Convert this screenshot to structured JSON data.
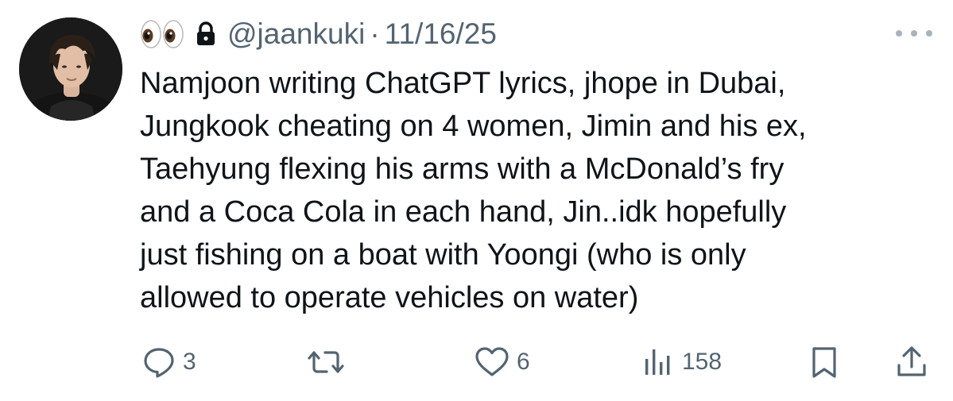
{
  "tweet": {
    "emoji_glyph": "👀",
    "emoji_icon": "eyes-emoji-icon",
    "lock_icon": "lock-icon",
    "handle": "@jaankuki",
    "separator": "·",
    "date": "11/16/25",
    "more_icon": "more-options-icon",
    "text_lines": [
      "Namjoon writing ChatGPT lyrics, jhope in Dubai,",
      "Jungkook cheating on 4 women, Jimin and his ex,",
      "Taehyung flexing his arms with a McDonald’s fry",
      "and a Coca Cola in each hand, Jin..idk hopefully",
      "just fishing on a boat with Yoongi (who is only",
      "allowed to operate vehicles on water)"
    ]
  },
  "actions": {
    "reply": {
      "icon": "reply-icon",
      "count": "3"
    },
    "retweet": {
      "icon": "retweet-icon"
    },
    "like": {
      "icon": "heart-icon",
      "count": "6"
    },
    "views": {
      "icon": "views-chart-icon",
      "count": "158"
    },
    "bookmark": {
      "icon": "bookmark-icon"
    },
    "share": {
      "icon": "share-icon"
    }
  },
  "colors": {
    "text": "#0f1419",
    "secondary": "#536471",
    "more_dots": "#a8b3bc"
  }
}
